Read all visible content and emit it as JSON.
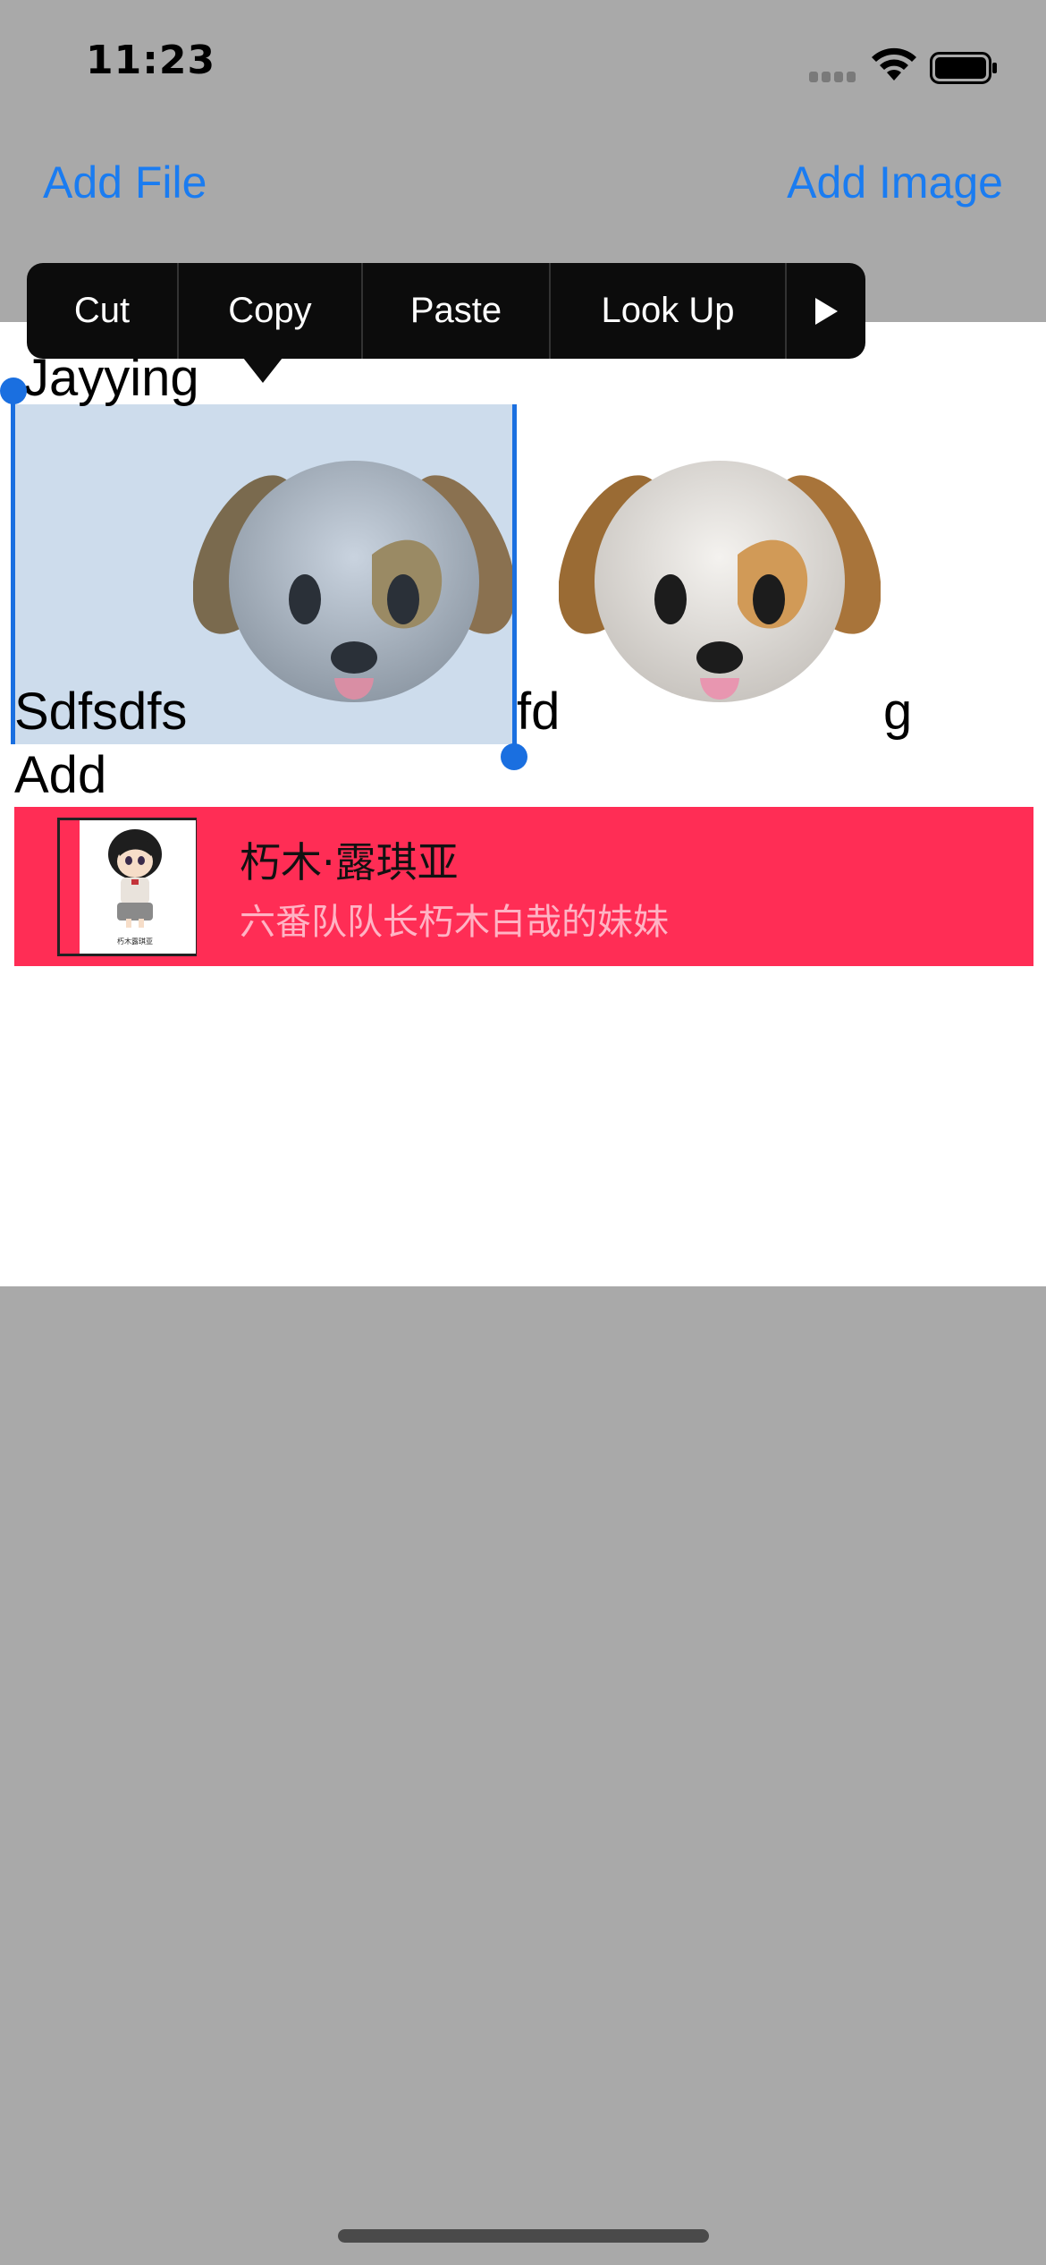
{
  "status_bar": {
    "time": "11:23",
    "wifi_icon": "wifi-icon",
    "battery_icon": "battery-icon",
    "signal_icon": "signal-icon"
  },
  "nav": {
    "add_file_label": "Add File",
    "add_image_label": "Add Image",
    "accent_color": "#1a7cf1"
  },
  "context_menu": {
    "items": [
      "Cut",
      "Copy",
      "Paste",
      "Look Up"
    ],
    "more_icon": "play-right-icon"
  },
  "text_content": {
    "line1": "Jayying",
    "line2_left": "Sdfsdfs",
    "line2_mid": "fd",
    "line2_right": "g",
    "line3": "Add",
    "attachments": [
      "dog-face-emoji",
      "dog-face-emoji"
    ]
  },
  "card": {
    "title": "朽木·露琪亚",
    "subtitle": "六番队队长朽木白哉的妹妹",
    "background": "#ff2d55",
    "thumb_caption": "朽木露琪亚"
  }
}
